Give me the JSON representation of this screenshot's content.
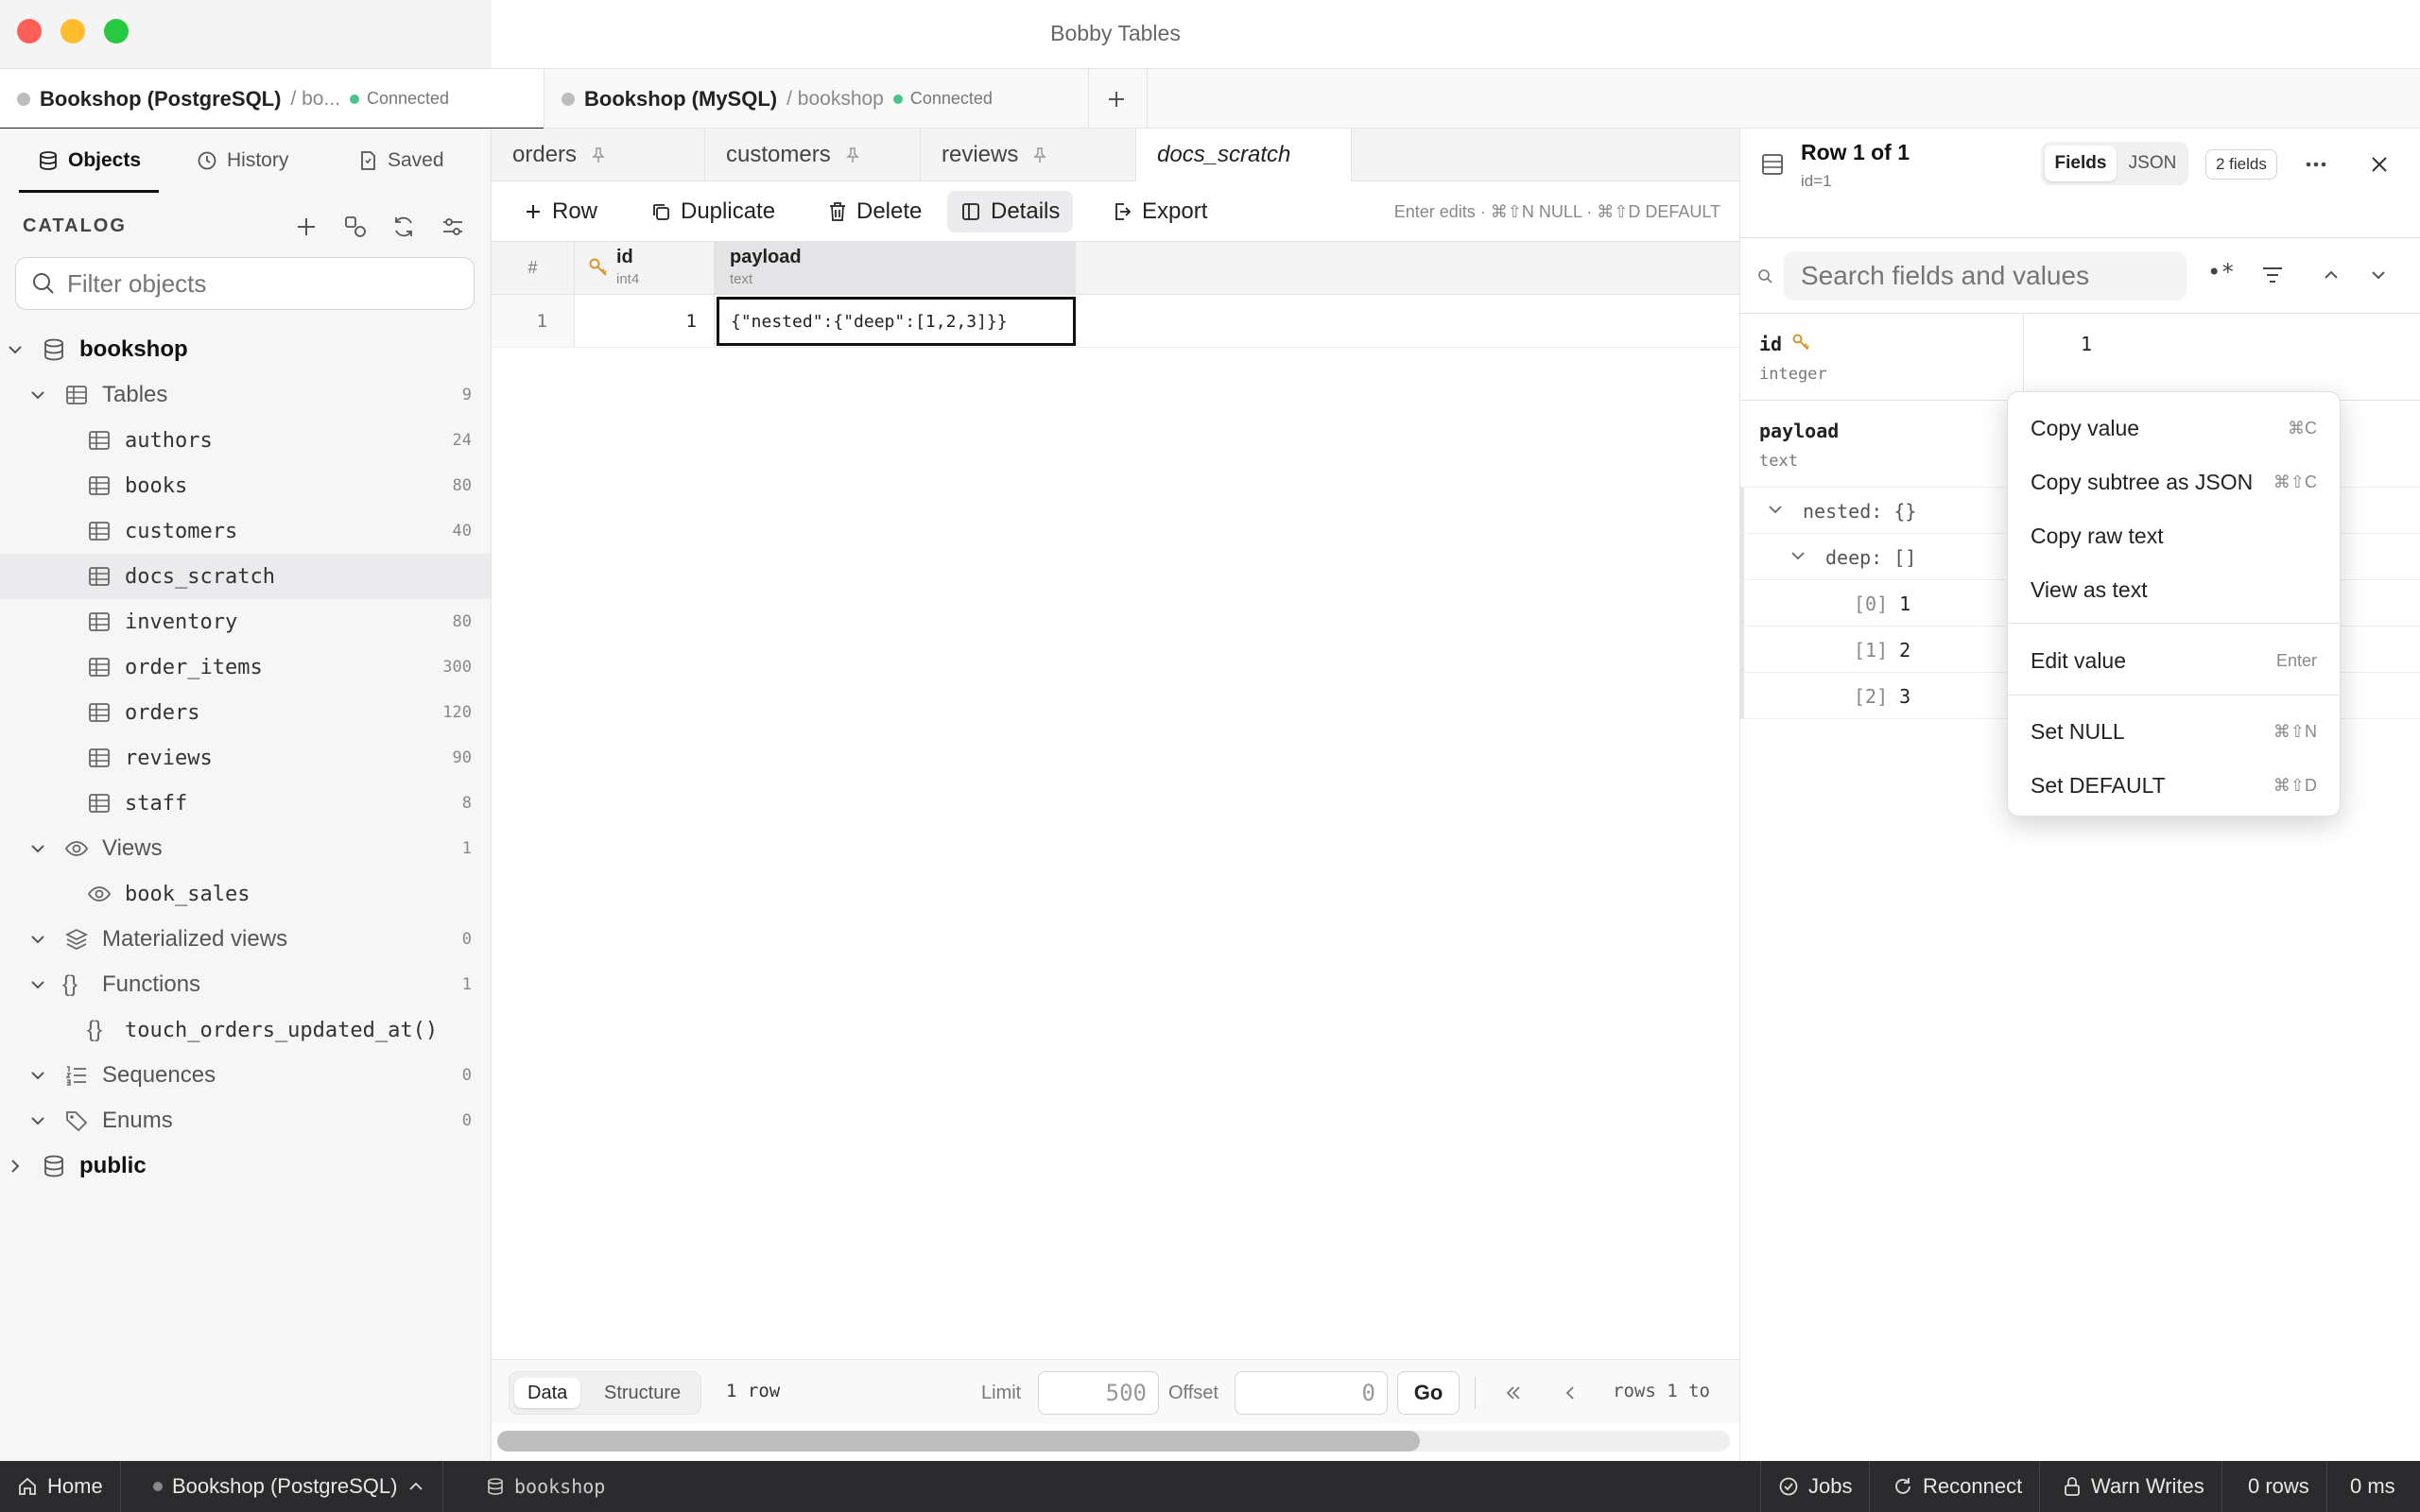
{
  "window": {
    "title": "Bobby Tables"
  },
  "connection_tabs": [
    {
      "name": "Bookshop (PostgreSQL)",
      "db": "bo...",
      "status": "Connected"
    },
    {
      "name": "Bookshop (MySQL)",
      "db": "bookshop",
      "status": "Connected"
    }
  ],
  "sidebar": {
    "tabs": [
      {
        "label": "Objects"
      },
      {
        "label": "History"
      },
      {
        "label": "Saved"
      }
    ],
    "catalog_label": "CATALOG",
    "filter_placeholder": "Filter objects",
    "tree": {
      "root": "bookshop",
      "tables_label": "Tables",
      "tables_count": "9",
      "tables": [
        {
          "name": "authors",
          "count": "24"
        },
        {
          "name": "books",
          "count": "80"
        },
        {
          "name": "customers",
          "count": "40"
        },
        {
          "name": "docs_scratch",
          "count": ""
        },
        {
          "name": "inventory",
          "count": "80"
        },
        {
          "name": "order_items",
          "count": "300"
        },
        {
          "name": "orders",
          "count": "120"
        },
        {
          "name": "reviews",
          "count": "90"
        },
        {
          "name": "staff",
          "count": "8"
        }
      ],
      "views_label": "Views",
      "views_count": "1",
      "views": [
        {
          "name": "book_sales"
        }
      ],
      "matviews_label": "Materialized views",
      "matviews_count": "0",
      "functions_label": "Functions",
      "functions_count": "1",
      "functions": [
        {
          "name": "touch_orders_updated_at()"
        }
      ],
      "sequences_label": "Sequences",
      "sequences_count": "0",
      "enums_label": "Enums",
      "enums_count": "0",
      "public": "public"
    }
  },
  "editor_tabs": [
    {
      "label": "orders"
    },
    {
      "label": "customers"
    },
    {
      "label": "reviews"
    },
    {
      "label": "docs_scratch"
    }
  ],
  "toolbar": {
    "row": "Row",
    "duplicate": "Duplicate",
    "delete": "Delete",
    "details": "Details",
    "export": "Export",
    "hint": "Enter edits · ⌘⇧N NULL · ⌘⇧D DEFAULT"
  },
  "grid": {
    "rownum_header": "#",
    "columns": [
      {
        "name": "id",
        "type": "int4"
      },
      {
        "name": "payload",
        "type": "text"
      }
    ],
    "rows": [
      {
        "num": "1",
        "id": "1",
        "payload": "{\"nested\":{\"deep\":[1,2,3]}}"
      }
    ]
  },
  "pager": {
    "data": "Data",
    "structure": "Structure",
    "rowcount": "1 row",
    "limit_label": "Limit",
    "limit": "500",
    "offset_label": "Offset",
    "offset": "0",
    "go": "Go",
    "range": "rows 1 to"
  },
  "details": {
    "title": "Row 1 of 1",
    "subtitle": "id=1",
    "view_fields": "Fields",
    "view_json": "JSON",
    "field_count": "2 fields",
    "search_placeholder": "Search fields and values",
    "fields": [
      {
        "name": "id",
        "type": "integer",
        "value": "1"
      },
      {
        "name": "payload",
        "type": "text"
      }
    ],
    "json_tree": [
      {
        "key": "nested:",
        "val": "{}"
      },
      {
        "key": "deep:",
        "val": "[]"
      },
      {
        "key": "[0]",
        "val": "1"
      },
      {
        "key": "[1]",
        "val": "2"
      },
      {
        "key": "[2]",
        "val": "3"
      }
    ]
  },
  "context_menu": {
    "items": [
      {
        "label": "Copy value",
        "key": "⌘C"
      },
      {
        "label": "Copy subtree as JSON",
        "key": "⌘⇧C"
      },
      {
        "label": "Copy raw text",
        "key": ""
      },
      {
        "label": "View as text",
        "key": ""
      },
      {
        "label": "Edit value",
        "key": "Enter"
      },
      {
        "label": "Set NULL",
        "key": "⌘⇧N"
      },
      {
        "label": "Set DEFAULT",
        "key": "⌘⇧D"
      }
    ]
  },
  "statusbar": {
    "home": "Home",
    "connection": "Bookshop (PostgreSQL)",
    "db": "bookshop",
    "jobs": "Jobs",
    "reconnect": "Reconnect",
    "warn": "Warn Writes",
    "rows": "0 rows",
    "ms": "0 ms"
  },
  "colors": {
    "accent": "#222222",
    "connected": "#4cc38a",
    "key": "#d4952b"
  }
}
